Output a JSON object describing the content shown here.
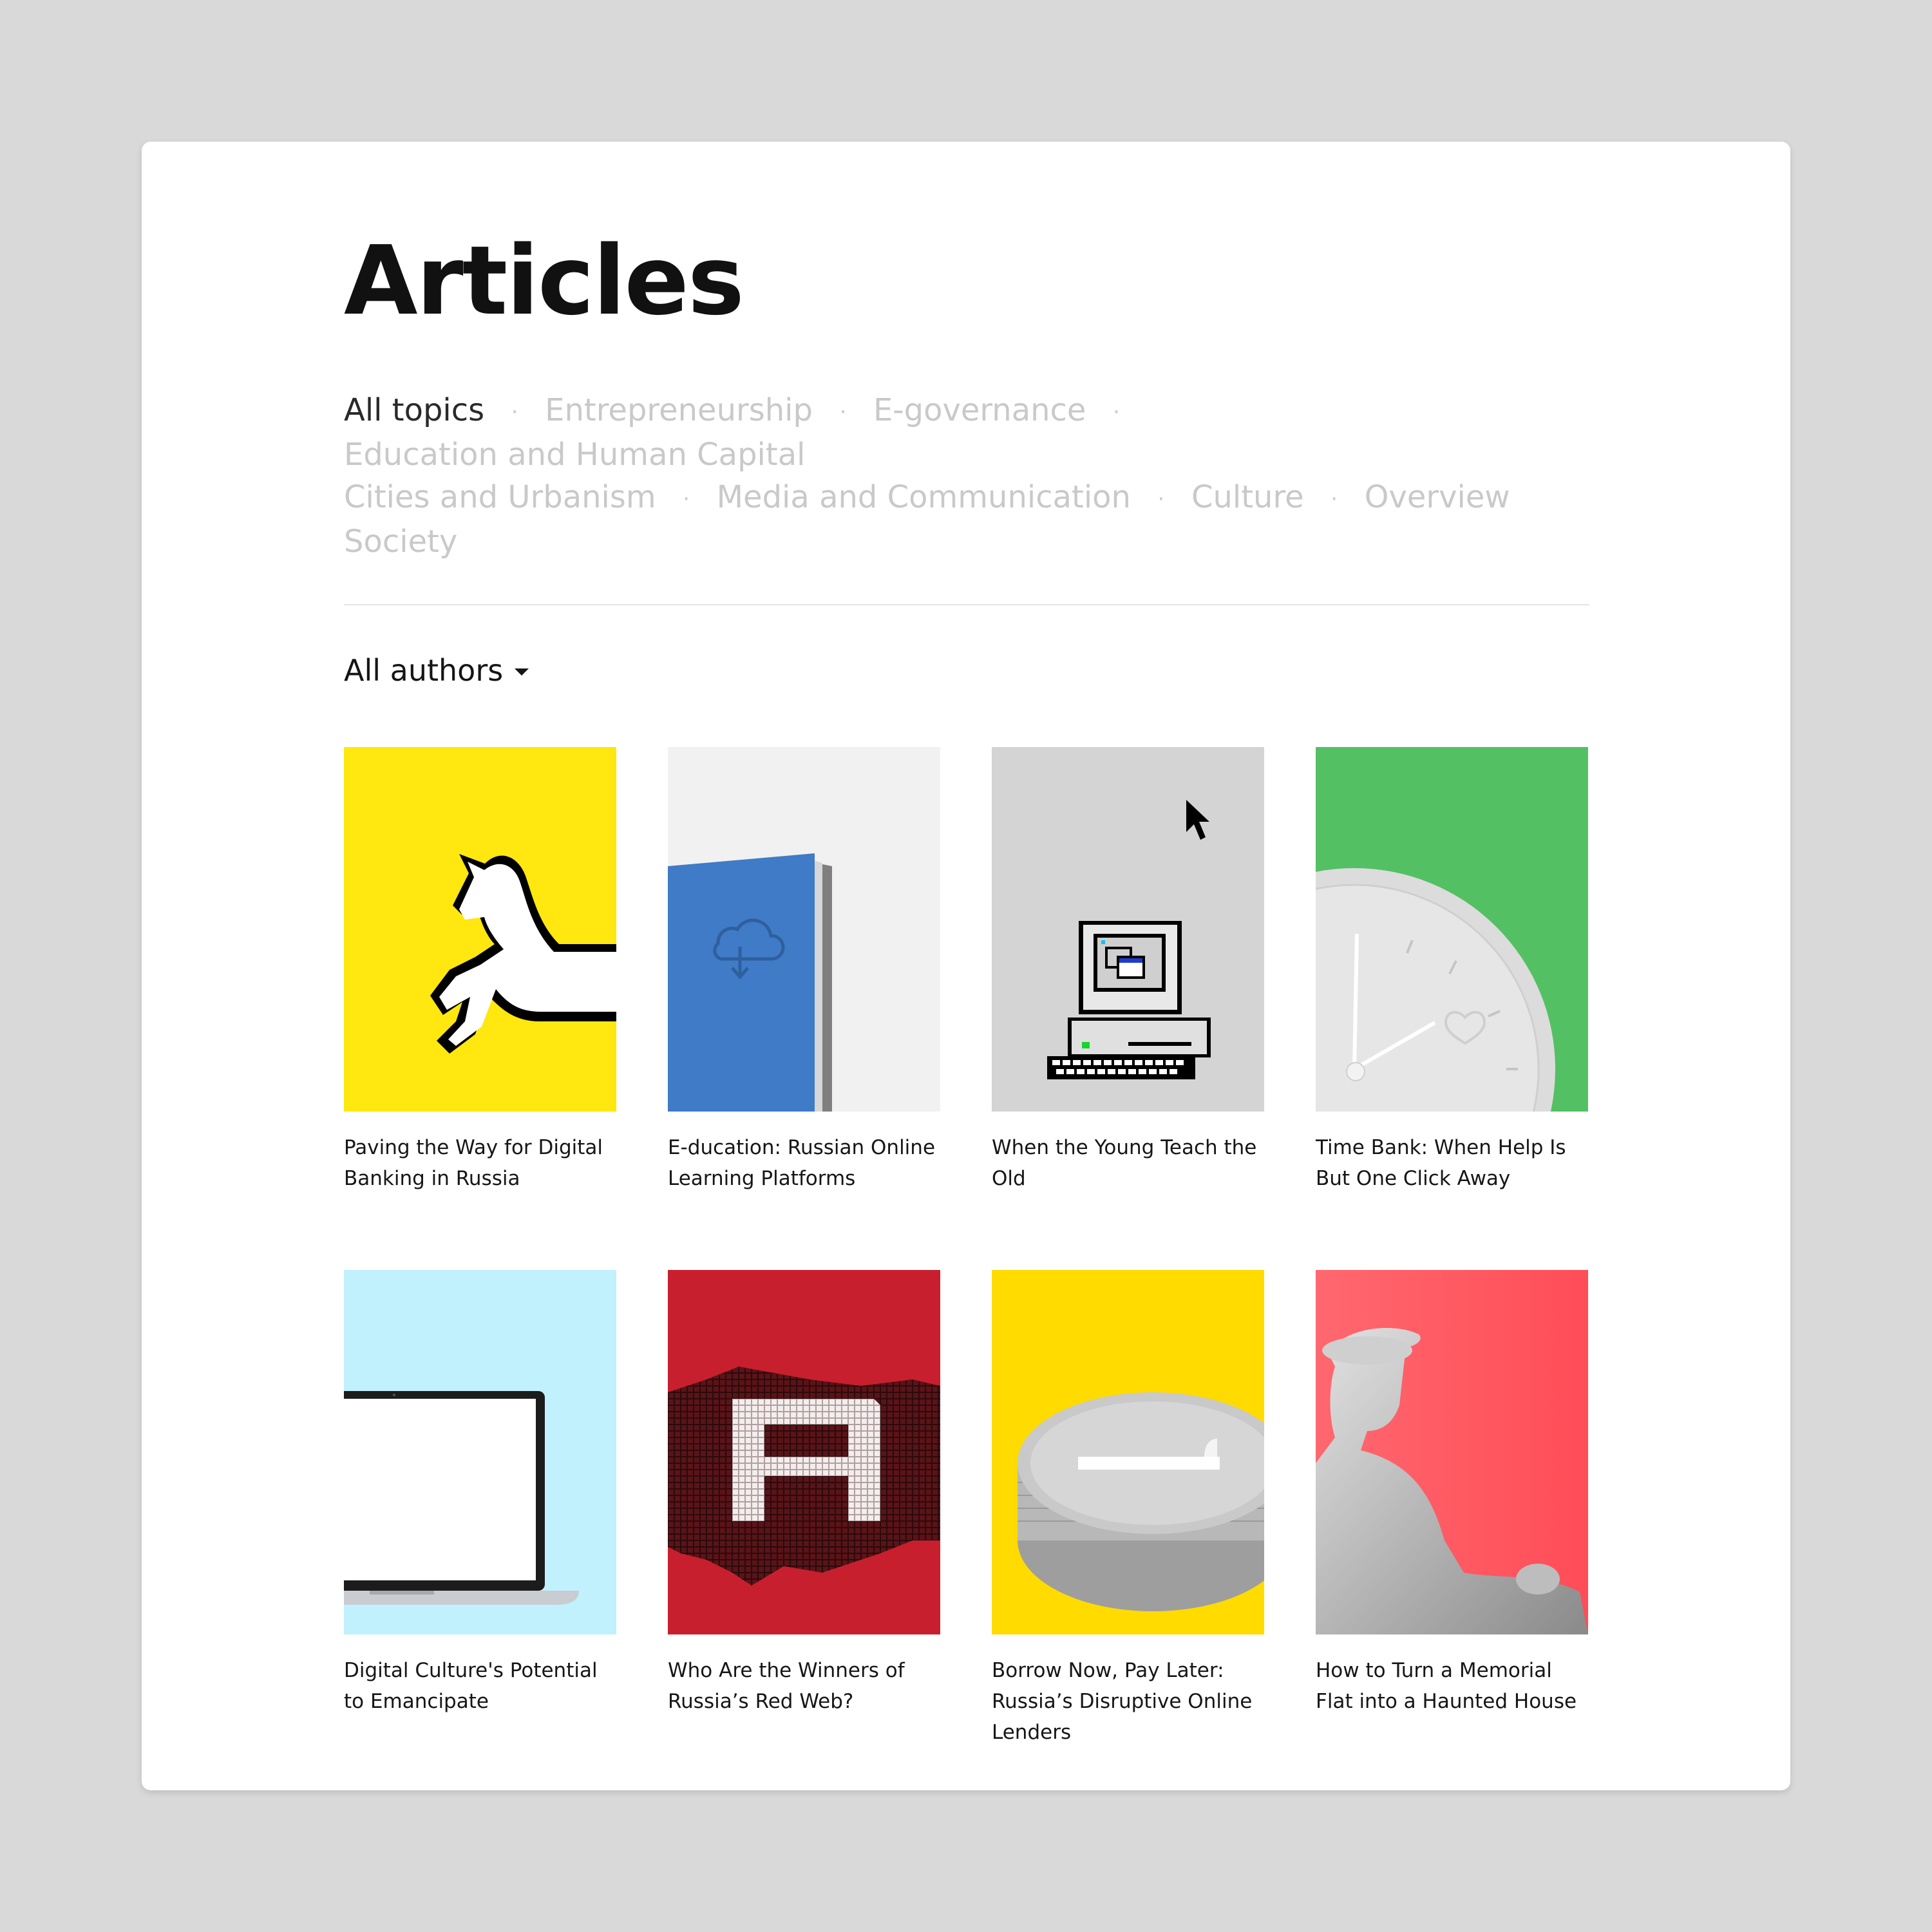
{
  "page": {
    "title": "Articles"
  },
  "topics": [
    "All topics",
    "Entrepreneurship",
    "E-governance",
    "Education and Human Capital",
    "Cities and Urbanism",
    "Media and Communication",
    "Culture",
    "Overview",
    "Society"
  ],
  "filters": {
    "authors_label": "All authors"
  },
  "articles": [
    {
      "title": "Paving the Way for Digital Banking in Russia",
      "bg": "#ffe70f",
      "icon": "unicorn"
    },
    {
      "title": "E-ducation: Russian Online Learning Platforms",
      "bg": "#f1f1f1",
      "icon": "book-cloud"
    },
    {
      "title": "When the Young Teach the Old",
      "bg": "#d4d4d4",
      "icon": "retro-computer"
    },
    {
      "title": "Time Bank: When Help Is But One Click Away",
      "bg": "#54c064",
      "icon": "clock"
    },
    {
      "title": "Digital Culture's Potential to Emancipate",
      "bg": "#c0f1fd",
      "icon": "laptop"
    },
    {
      "title": "Who Are the Winners of Russia’s Red Web?",
      "bg": "#c81f2e",
      "icon": "pixel-letter-r"
    },
    {
      "title": "Borrow Now, Pay Later: Russia’s Disruptive Online Lenders",
      "bg": "#ffdb00",
      "icon": "coin-stack"
    },
    {
      "title": "How to Turn a Memorial Flat into a Haunted House",
      "bg": "#ff5a62",
      "icon": "statue"
    }
  ]
}
